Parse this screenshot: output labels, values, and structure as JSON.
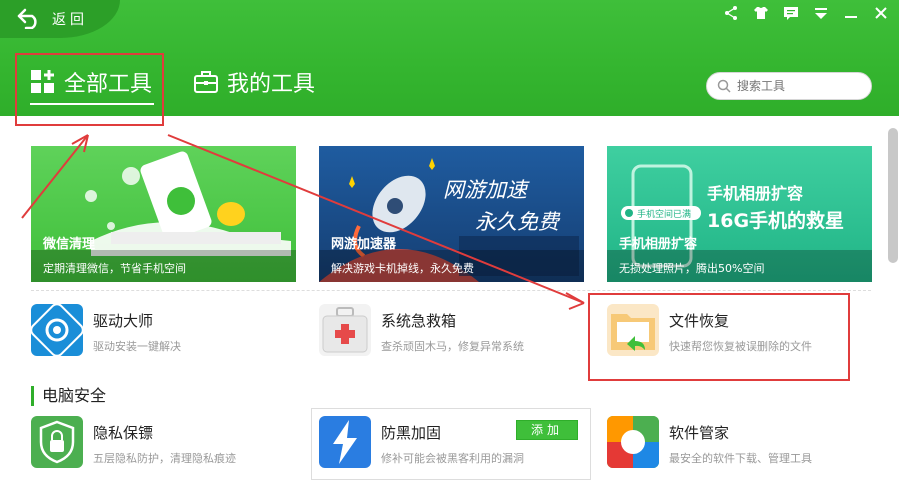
{
  "header": {
    "back_label": "返回",
    "tabs": [
      {
        "label": "全部工具"
      },
      {
        "label": "我的工具"
      }
    ],
    "search": {
      "placeholder": "搜索工具"
    }
  },
  "banners": [
    {
      "title": "微信清理",
      "subtitle": "定期清理微信，节省手机空间"
    },
    {
      "title": "网游加速器",
      "subtitle": "解决游戏卡机掉线，永久免费",
      "art_text_1": "网游加速",
      "art_text_2": "永久免费"
    },
    {
      "title": "手机相册扩容",
      "subtitle": "无损处理照片，腾出50%空间",
      "art_text_1": "手机相册扩容",
      "art_text_2": "16G手机的救星",
      "art_tag": "手机空间已满"
    }
  ],
  "tools_row1": [
    {
      "name": "驱动大师",
      "desc": "驱动安装一键解决"
    },
    {
      "name": "系统急救箱",
      "desc": "查杀顽固木马，修复异常系统"
    },
    {
      "name": "文件恢复",
      "desc": "快速帮您恢复被误删除的文件"
    }
  ],
  "section": {
    "title": "电脑安全"
  },
  "tools_row2": [
    {
      "name": "隐私保镖",
      "desc": "五层隐私防护，清理隐私痕迹"
    },
    {
      "name": "防黑加固",
      "desc": "修补可能会被黑客利用的漏洞",
      "button": "添加"
    },
    {
      "name": "软件管家",
      "desc": "最安全的软件下载、管理工具"
    }
  ],
  "colors": {
    "brand_green": "#3fbf3a",
    "highlight_red": "#e03c3c"
  }
}
